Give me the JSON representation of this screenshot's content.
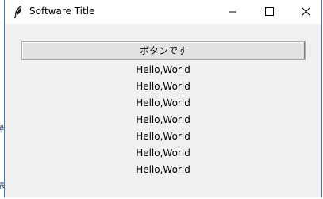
{
  "window": {
    "title": "Software Title"
  },
  "main": {
    "button_label": "ボタンです",
    "labels": [
      "Hello,World",
      "Hello,World",
      "Hello,World",
      "Hello,World",
      "Hello,World",
      "Hello,World",
      "Hello,World"
    ]
  },
  "desktop": {
    "edge_glyph_1": "#",
    "edge_glyph_2": "表"
  },
  "icons": {
    "app": "feather-icon",
    "minimize": "minimize-icon",
    "maximize": "maximize-icon",
    "close": "close-icon"
  }
}
